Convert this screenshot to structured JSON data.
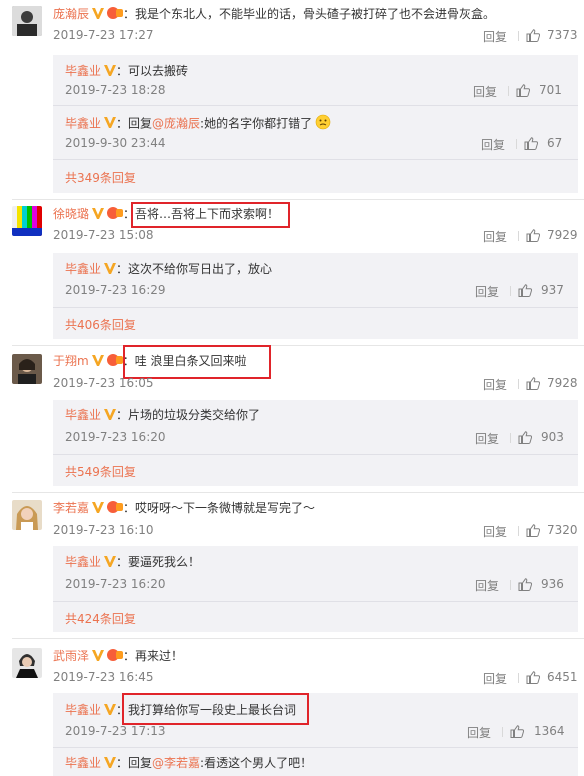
{
  "comments": [
    {
      "user": "庞瀚辰",
      "text": "：我是个东北人，不能毕业的话，骨头碴子被打碎了也不会进骨灰盒。",
      "time": "2019-7-23 17:27",
      "reply_label": "回复",
      "likes": "7373",
      "replies": [
        {
          "user": "毕鑫业",
          "sep": "：",
          "mention": "",
          "text": "可以去搬砖",
          "time": "2019-7-23 18:28",
          "reply_label": "回复",
          "likes": "701"
        },
        {
          "user": "毕鑫业",
          "sep": "：回复",
          "mention": "@庞瀚辰",
          "text": ":她的名字你都打错了",
          "time": "2019-9-30 23:44",
          "reply_label": "回复",
          "likes": "67"
        }
      ],
      "total": "共349条回复"
    },
    {
      "user": "徐晓璐",
      "text": "：吾将…吾将上下而求索啊！",
      "time": "2019-7-23 15:08",
      "reply_label": "回复",
      "likes": "7929",
      "replies": [
        {
          "user": "毕鑫业",
          "sep": "：",
          "mention": "",
          "text": "这次不给你写日出了，放心",
          "time": "2019-7-23 16:29",
          "reply_label": "回复",
          "likes": "937"
        }
      ],
      "total": "共406条回复"
    },
    {
      "user": "于翔m",
      "text": "：哇 浪里白条又回来啦",
      "time": "2019-7-23 16:05",
      "reply_label": "回复",
      "likes": "7928",
      "replies": [
        {
          "user": "毕鑫业",
          "sep": "：",
          "mention": "",
          "text": "片场的垃圾分类交给你了",
          "time": "2019-7-23 16:20",
          "reply_label": "回复",
          "likes": "903"
        }
      ],
      "total": "共549条回复"
    },
    {
      "user": "李若嘉",
      "text": "：哎呀呀～下一条微博就是写完了～",
      "time": "2019-7-23 16:10",
      "reply_label": "回复",
      "likes": "7320",
      "replies": [
        {
          "user": "毕鑫业",
          "sep": "：",
          "mention": "",
          "text": "要逼死我么！",
          "time": "2019-7-23 16:20",
          "reply_label": "回复",
          "likes": "936"
        }
      ],
      "total": "共424条回复"
    },
    {
      "user": "武雨泽",
      "text": "：再来过！",
      "time": "2019-7-23 16:45",
      "reply_label": "回复",
      "likes": "6451",
      "replies": [
        {
          "user": "毕鑫业",
          "sep": "：",
          "mention": "",
          "text": "我打算给你写一段史上最长台词",
          "time": "2019-7-23 17:13",
          "reply_label": "回复",
          "likes": "1364"
        },
        {
          "user": "毕鑫业",
          "sep": "：回复",
          "mention": "@李若嘉",
          "text": ":看透这个男人了吧！",
          "time": "",
          "reply_label": "",
          "likes": ""
        }
      ],
      "total": ""
    }
  ],
  "colors": {
    "accent": "#eb7350",
    "highlight": "#e0242a",
    "reply_bg": "#f2f2f5"
  },
  "icons": [
    "vip-badge-icon",
    "member-badge-icon",
    "thumb-up-icon",
    "emoji-icon"
  ]
}
